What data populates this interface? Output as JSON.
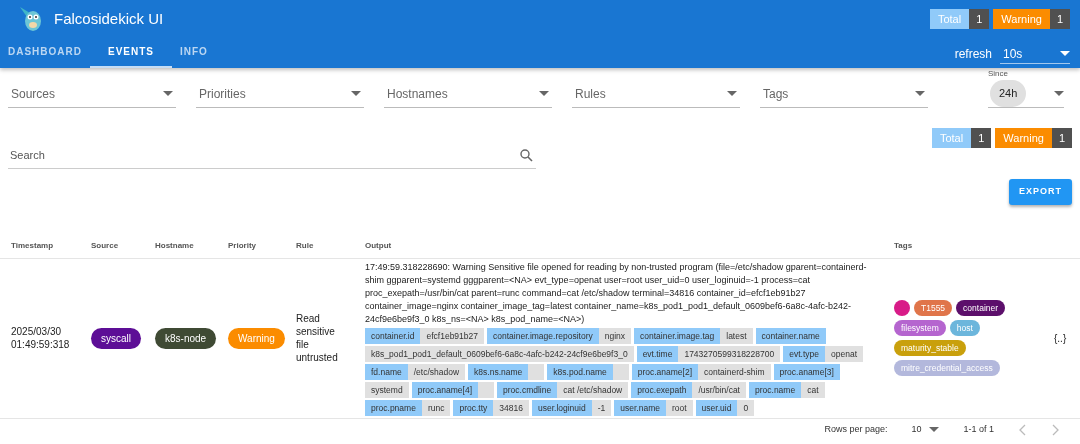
{
  "app": {
    "title": "Falcosidekick UI"
  },
  "header_counters": [
    {
      "label": "Total",
      "count": "1",
      "color": "#90caf9"
    },
    {
      "label": "Warning",
      "count": "1",
      "color": "#fb8c00"
    }
  ],
  "tabs": [
    {
      "label": "DASHBOARD",
      "selected": false
    },
    {
      "label": "EVENTS",
      "selected": true
    },
    {
      "label": "INFO",
      "selected": false
    }
  ],
  "refresh": {
    "label": "refresh",
    "value": "10s"
  },
  "filters": [
    {
      "placeholder": "Sources"
    },
    {
      "placeholder": "Priorities"
    },
    {
      "placeholder": "Hostnames"
    },
    {
      "placeholder": "Rules"
    },
    {
      "placeholder": "Tags"
    }
  ],
  "since": {
    "label": "Since",
    "value": "24h"
  },
  "search": {
    "placeholder": "Search"
  },
  "counters": [
    {
      "label": "Total",
      "count": "1",
      "color": "#90caf9"
    },
    {
      "label": "Warning",
      "count": "1",
      "color": "#fb8c00"
    }
  ],
  "export_button": "EXPORT",
  "table": {
    "columns": [
      "Timestamp",
      "Source",
      "Hostname",
      "Priority",
      "Rule",
      "Output",
      "Tags"
    ],
    "rows": [
      {
        "timestamp_date": "2025/03/30",
        "timestamp_time": "01:49:59:318",
        "source": "syscall",
        "hostname": "k8s-node",
        "priority": "Warning",
        "rule": "Read sensitive file untrusted",
        "output": "17:49:59.318228690: Warning Sensitive file opened for reading by non-trusted program (file=/etc/shadow gparent=containerd-shim ggparent=systemd gggparent=<NA> evt_type=openat user=root user_uid=0 user_loginuid=-1 process=cat proc_exepath=/usr/bin/cat parent=runc command=cat /etc/shadow terminal=34816 container_id=efcf1eb91b27 container_image=nginx container_image_tag=latest container_name=k8s_pod1_pod1_default_0609bef6-6a8c-4afc-b242-24cf9e6be9f3_0 k8s_ns=<NA> k8s_pod_name=<NA>)",
        "fields": [
          {
            "key": "container.id",
            "value": "efcf1eb91b27"
          },
          {
            "key": "container.image.repository",
            "value": "nginx"
          },
          {
            "key": "container.image.tag",
            "value": "latest"
          },
          {
            "key": "container.name",
            "value": "k8s_pod1_pod1_default_0609bef6-6a8c-4afc-b242-24cf9e6be9f3_0"
          },
          {
            "key": "evt.time",
            "value": "1743270599318228700"
          },
          {
            "key": "evt.type",
            "value": "openat"
          },
          {
            "key": "fd.name",
            "value": "/etc/shadow"
          },
          {
            "key": "k8s.ns.name"
          },
          {
            "key": "k8s.pod.name"
          },
          {
            "key": "proc.aname[2]",
            "value": "containerd-shim"
          },
          {
            "key": "proc.aname[3]",
            "value": "systemd"
          },
          {
            "key": "proc.aname[4]"
          },
          {
            "key": "proc.cmdline",
            "value": "cat /etc/shadow"
          },
          {
            "key": "proc.exepath",
            "value": "/usr/bin/cat"
          },
          {
            "key": "proc.name",
            "value": "cat"
          },
          {
            "key": "proc.pname",
            "value": "runc"
          },
          {
            "key": "proc.tty",
            "value": "34816"
          },
          {
            "key": "user.loginuid",
            "value": "-1"
          },
          {
            "key": "user.name",
            "value": "root"
          },
          {
            "key": "user.uid",
            "value": "0"
          }
        ],
        "tags": [
          {
            "color": "#d81b88"
          },
          {
            "label": "T1555",
            "color": "#e0754a"
          },
          {
            "label": "container",
            "color": "#5c0f6b"
          },
          {
            "label": "filesystem",
            "color": "#b565cf"
          },
          {
            "label": "host",
            "color": "#6cb6dc"
          },
          {
            "label": "maturity_stable",
            "color": "#c9a00c"
          },
          {
            "label": "mitre_credential_access",
            "color": "#b3b8dc"
          }
        ],
        "details": "{..}"
      }
    ]
  },
  "pagination": {
    "rows_label": "Rows per page:",
    "rows_value": "10",
    "range": "1-1 of 1"
  }
}
